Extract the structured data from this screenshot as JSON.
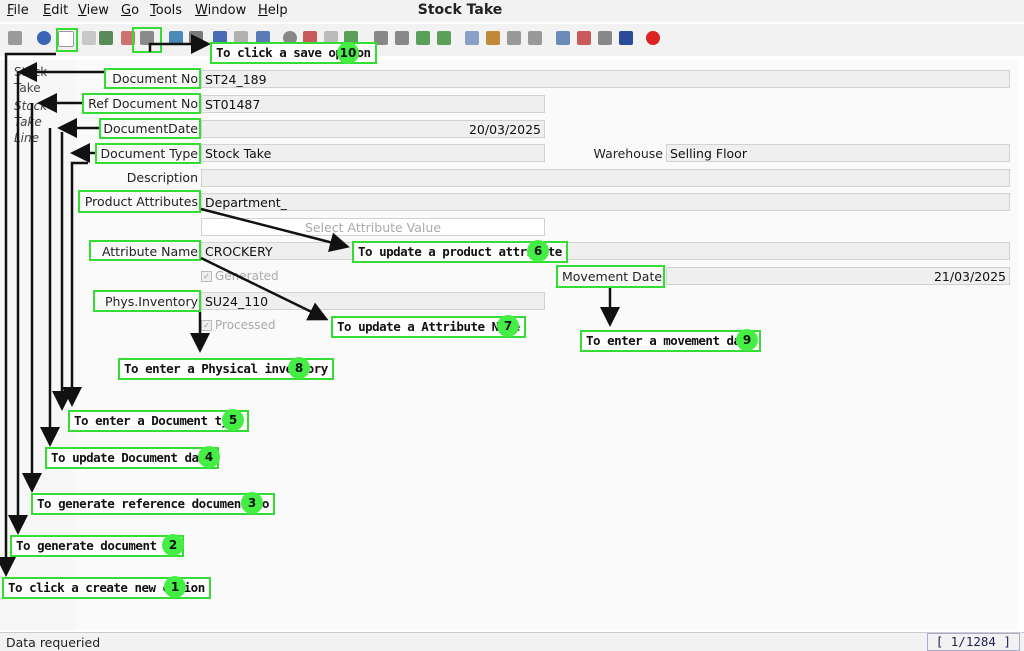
{
  "app": {
    "title": "Stock Take"
  },
  "menu": [
    "File",
    "Edit",
    "View",
    "Go",
    "Tools",
    "Window",
    "Help"
  ],
  "toolbar": {
    "icons": [
      "undo-icon",
      "help-icon",
      "new-record-icon",
      "copy-icon",
      "delete-icon",
      "cut-icon",
      "save-icon",
      "refresh-icon",
      "find-icon",
      "attachment-icon",
      "history-icon",
      "grid-toggle-icon",
      "home-icon",
      "parent-icon",
      "prev-icon",
      "next-icon",
      "first-icon",
      "up-icon",
      "down-icon",
      "last-icon",
      "report-icon",
      "archive-icon",
      "print-icon",
      "print-preview-icon",
      "zoom-icon",
      "workflow-icon",
      "process-icon",
      "close-window-icon",
      "exit-icon"
    ]
  },
  "sidebar": {
    "tabs": [
      {
        "label": "Stock Take"
      },
      {
        "label": "Stock Take Line"
      }
    ]
  },
  "form": {
    "document_no": {
      "label": "Document No",
      "value": "ST24_189"
    },
    "ref_document_no": {
      "label": "Ref Document No",
      "value": "ST01487"
    },
    "document_date": {
      "label": "DocumentDate",
      "value": "20/03/2025"
    },
    "document_type": {
      "label": "Document Type",
      "value": "Stock Take"
    },
    "warehouse": {
      "label": "Warehouse",
      "value": "Selling Floor"
    },
    "description": {
      "label": "Description",
      "value": ""
    },
    "product_attributes": {
      "label": "Product Attributes",
      "value": "Department_"
    },
    "select_attribute_value": {
      "label": "Select Attribute Value"
    },
    "attribute_name": {
      "label": "Attribute Name",
      "value": "CROCKERY"
    },
    "generated": {
      "label": "Generated",
      "checked": true
    },
    "movement_date": {
      "label": "Movement Date",
      "value": "21/03/2025"
    },
    "phys_inventory": {
      "label": "Phys.Inventory",
      "value": "SU24_110"
    },
    "processed": {
      "label": "Processed",
      "checked": true
    }
  },
  "annotations": [
    {
      "num": "1",
      "text": "To click a create new option"
    },
    {
      "num": "2",
      "text": "To generate document no"
    },
    {
      "num": "3",
      "text": "To  generate reference document no"
    },
    {
      "num": "4",
      "text": "To update Document date"
    },
    {
      "num": "5",
      "text": "To enter a Document type"
    },
    {
      "num": "6",
      "text": "To update a product attribute"
    },
    {
      "num": "7",
      "text": "To update a Attribute Name"
    },
    {
      "num": "8",
      "text": "To enter a Physical inventory"
    },
    {
      "num": "9",
      "text": "To enter a movement date"
    },
    {
      "num": "10",
      "text": "To click a save option"
    }
  ],
  "status": {
    "message": "Data requeried",
    "record_count": "[ 1/1284 ]"
  },
  "colors": {
    "highlight": "#33dd33",
    "badge": "#44ee44",
    "field_bg": "#efefef"
  }
}
